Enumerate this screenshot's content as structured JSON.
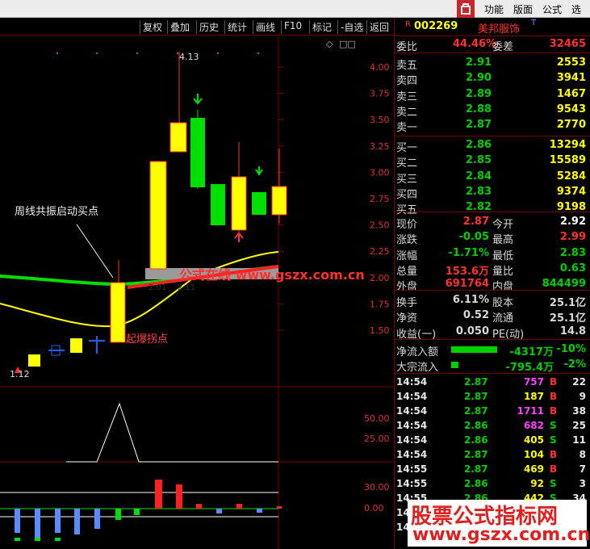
{
  "topbar": {
    "menus": [
      "功能",
      "版面",
      "公式",
      "选项"
    ]
  },
  "toolbar": {
    "buttons": [
      "复权",
      "叠加",
      "历史",
      "统计",
      "画线",
      "F10",
      "标记",
      "-自选",
      "返回"
    ],
    "diamond": "◇",
    "squares": "□□"
  },
  "chart": {
    "annotation_startpoint": "周线共振启动买点",
    "annotation_stage": "起爆拐点",
    "high_marker": "4.13",
    "low_marker": "1.12",
    "mid_marker": "2.01",
    "mid_marker2": "2.11",
    "watermark_inline": "公式在线 www.gszx.com.cn",
    "price_axis": [
      "4.00",
      "3.75",
      "3.50",
      "3.25",
      "3.00",
      "2.75",
      "2.50",
      "2.25",
      "2.00",
      "1.75",
      "1.50"
    ],
    "indicator1_axis": [
      "50.00",
      "25.00"
    ],
    "indicator2_axis": [
      "30.00",
      "0.00"
    ]
  },
  "quote": {
    "code": "002269",
    "name": "美邦服饰",
    "flag": "R",
    "superscript": "T",
    "weibi_label": "委比",
    "weibi_value": "44.46%",
    "weicha_label": "委差",
    "weicha_value": "32465",
    "asks": [
      {
        "label": "卖五",
        "price": "2.91",
        "vol": "2553"
      },
      {
        "label": "卖四",
        "price": "2.90",
        "vol": "3941"
      },
      {
        "label": "卖三",
        "price": "2.89",
        "vol": "1467"
      },
      {
        "label": "卖二",
        "price": "2.88",
        "vol": "9543"
      },
      {
        "label": "卖一",
        "price": "2.87",
        "vol": "2770"
      }
    ],
    "bids": [
      {
        "label": "买一",
        "price": "2.86",
        "vol": "13294"
      },
      {
        "label": "买二",
        "price": "2.85",
        "vol": "15589"
      },
      {
        "label": "买三",
        "price": "2.84",
        "vol": "5284"
      },
      {
        "label": "买四",
        "price": "2.83",
        "vol": "9374"
      },
      {
        "label": "买五",
        "price": "2.82",
        "vol": "9198"
      }
    ],
    "stats": [
      {
        "l1": "现价",
        "v1": "2.87",
        "l2": "今开",
        "v2": "2.92"
      },
      {
        "l1": "涨跌",
        "v1": "-0.05",
        "l2": "最高",
        "v2": "2.99"
      },
      {
        "l1": "涨幅",
        "v1": "-1.71%",
        "l2": "最低",
        "v2": "2.83"
      },
      {
        "l1": "总量",
        "v1": "153.6万",
        "l2": "量比",
        "v2": "0.63"
      },
      {
        "l1": "外盘",
        "v1": "691764",
        "l2": "内盘",
        "v2": "844499"
      }
    ],
    "stats2": [
      {
        "l1": "换手",
        "v1": "6.11%",
        "l2": "股本",
        "v2": "25.1亿"
      },
      {
        "l1": "净资",
        "v1": "0.52",
        "l2": "流通",
        "v2": "25.1亿"
      },
      {
        "l1": "收益(一)",
        "v1": "0.050",
        "l2": "PE(动)",
        "v2": "14.8"
      }
    ],
    "flows": [
      {
        "label": "净流入额",
        "value": "-4317万",
        "pct": "-10%",
        "bar": 0.75
      },
      {
        "label": "大宗流入",
        "value": "-795.4万",
        "pct": "-2%",
        "bar": 0.12
      }
    ],
    "ticks": [
      {
        "time": "14:54",
        "price": "2.87",
        "vol": "757",
        "side": "B",
        "n": "22"
      },
      {
        "time": "14:54",
        "price": "2.87",
        "vol": "187",
        "side": "B",
        "n": "9"
      },
      {
        "time": "14:54",
        "price": "2.87",
        "vol": "1711",
        "side": "B",
        "n": "38"
      },
      {
        "time": "14:54",
        "price": "2.86",
        "vol": "682",
        "side": "S",
        "n": "25"
      },
      {
        "time": "14:54",
        "price": "2.86",
        "vol": "405",
        "side": "S",
        "n": "11"
      },
      {
        "time": "14:54",
        "price": "2.87",
        "vol": "104",
        "side": "B",
        "n": "8"
      },
      {
        "time": "14:55",
        "price": "2.87",
        "vol": "469",
        "side": "B",
        "n": "7"
      },
      {
        "time": "14:55",
        "price": "2.86",
        "vol": "92",
        "side": "S",
        "n": "3"
      },
      {
        "time": "14:55",
        "price": "2.86",
        "vol": "442",
        "side": "S",
        "n": "34"
      },
      {
        "time": "14:55",
        "price": "",
        "vol": "",
        "side": "",
        "n": ""
      },
      {
        "time": "14:5",
        "price": "",
        "vol": "",
        "side": "",
        "n": ""
      }
    ]
  },
  "watermark": {
    "line1": "股票公式指标网",
    "line2": "www.gszx.com.cn"
  },
  "colors": {
    "up": "#ff3030",
    "down": "#00d000",
    "label": "#d8d8d8",
    "yellow": "#ffff00",
    "green": "#00e000",
    "magenta": "#ff40ff",
    "bg": "#000000"
  }
}
